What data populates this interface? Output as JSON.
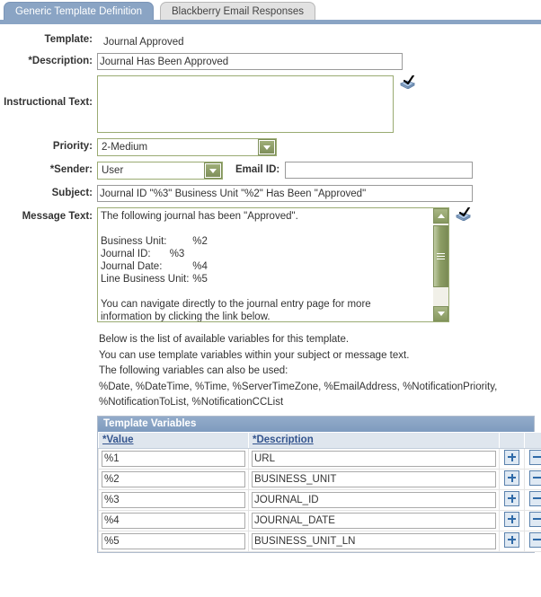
{
  "tabs": [
    {
      "label": "Generic Template Definition",
      "active": true
    },
    {
      "label": "Blackberry Email Responses",
      "active": false
    }
  ],
  "form": {
    "template": {
      "label": "Template:",
      "value": "Journal Approved"
    },
    "description": {
      "label": "*Description:",
      "value": "Journal Has Been Approved"
    },
    "instructional_text": {
      "label": "Instructional Text:",
      "value": "",
      "placeholder": ""
    },
    "priority": {
      "label": "Priority:",
      "value": "2-Medium"
    },
    "sender": {
      "label": "*Sender:",
      "value": "User"
    },
    "email_id": {
      "label": "Email ID:",
      "value": "",
      "placeholder": ""
    },
    "subject": {
      "label": "Subject:",
      "value": "Journal ID \"%3\" Business Unit \"%2\" Has Been \"Approved\""
    },
    "message_text": {
      "label": "Message Text:",
      "value": "The following journal has been \"Approved\".\n\nBusiness Unit:\t\t%2\nJournal ID:\t%3\nJournal Date:\t\t%4\nLine Business Unit:\t%5\n\nYou can navigate directly to the journal entry page for more\ninformation by clicking the link below."
    },
    "spellcheck_icon": "spellcheck-book-icon"
  },
  "help": {
    "line1": "Below is the list of available variables for this template.",
    "line2": "You can use template variables within your subject or message text.",
    "line3": "The following variables can also be used:",
    "line4": "%Date, %DateTime, %Time, %ServerTimeZone, %EmailAddress, %NotificationPriority,",
    "line5": "%NotificationToList, %NotificationCCList"
  },
  "grid": {
    "title": "Template Variables",
    "columns": [
      {
        "label": "*Value"
      },
      {
        "label": "*Description"
      }
    ],
    "rows": [
      {
        "value": "%1",
        "description": "URL"
      },
      {
        "value": "%2",
        "description": "BUSINESS_UNIT"
      },
      {
        "value": "%3",
        "description": "JOURNAL_ID"
      },
      {
        "value": "%4",
        "description": "JOURNAL_DATE"
      },
      {
        "value": "%5",
        "description": "BUSINESS_UNIT_LN"
      }
    ],
    "add_button_label": "+",
    "remove_button_label": "-"
  },
  "colors": {
    "tab_active_bg": "#8aa4c4",
    "tab_inactive_bg": "#e2e2e2",
    "grid_header_bg": "#7e9bbe",
    "grid_column_bg": "#dfe6ee",
    "field_green_border": "#9aab72",
    "dropdown_button": "#8d9e66",
    "link_blue": "#33548e"
  },
  "scrollbar": {
    "name": "message-text-vertical-scrollbar",
    "up_icon": "chevron-up-icon",
    "down_icon": "chevron-down-icon"
  }
}
